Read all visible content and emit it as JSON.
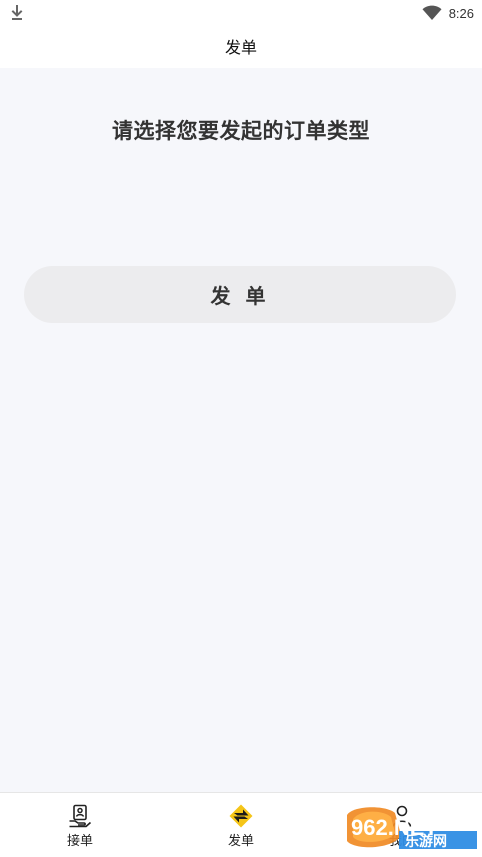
{
  "status_bar": {
    "time": "8:26",
    "download_icon": "download-icon",
    "wifi_icon": "wifi-icon"
  },
  "header": {
    "title": "发单"
  },
  "main": {
    "prompt": "请选择您要发起的订单类型",
    "order_types": [
      {
        "label": "发 单"
      }
    ]
  },
  "bottom_nav": {
    "items": [
      {
        "label": "接单",
        "icon": "receive-order-icon",
        "active": false
      },
      {
        "label": "发单",
        "icon": "send-order-icon",
        "active": true
      },
      {
        "label": "我的",
        "icon": "profile-icon",
        "active": false
      }
    ]
  },
  "watermark": {
    "text_top": "962.NET",
    "text_bottom": "乐游网"
  },
  "colors": {
    "main_background": "#f6f7fb",
    "button_background": "#ececee",
    "active_icon_yellow": "#f5c518",
    "text_dark": "#333333"
  }
}
